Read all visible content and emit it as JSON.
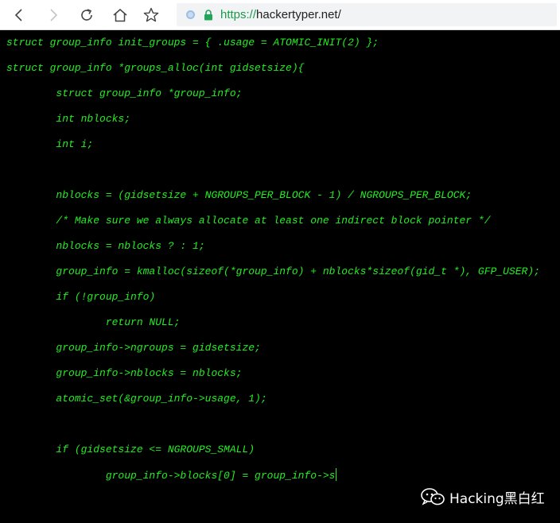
{
  "browser": {
    "url_scheme": "https://",
    "url_host": "hackertyper.net/",
    "icons": {
      "back": "back-arrow-icon",
      "forward": "forward-arrow-icon",
      "reload": "reload-icon",
      "home": "home-icon",
      "bookmark": "star-icon",
      "security": "lock-icon"
    }
  },
  "editor": {
    "text_color": "#22ee22",
    "background": "#000000",
    "lines": [
      "struct group_info init_groups = { .usage = ATOMIC_INIT(2) };",
      "struct group_info *groups_alloc(int gidsetsize){",
      "        struct group_info *group_info;",
      "        int nblocks;",
      "        int i;",
      "",
      "        nblocks = (gidsetsize + NGROUPS_PER_BLOCK - 1) / NGROUPS_PER_BLOCK;",
      "        /* Make sure we always allocate at least one indirect block pointer */",
      "        nblocks = nblocks ? : 1;",
      "        group_info = kmalloc(sizeof(*group_info) + nblocks*sizeof(gid_t *), GFP_USER);",
      "        if (!group_info)",
      "                return NULL;",
      "        group_info->ngroups = gidsetsize;",
      "        group_info->nblocks = nblocks;",
      "        atomic_set(&group_info->usage, 1);",
      "",
      "        if (gidsetsize <= NGROUPS_SMALL)",
      "                group_info->blocks[0] = group_info->s"
    ]
  },
  "watermark": {
    "text": "Hacking黑白红",
    "icon": "wechat-icon"
  }
}
